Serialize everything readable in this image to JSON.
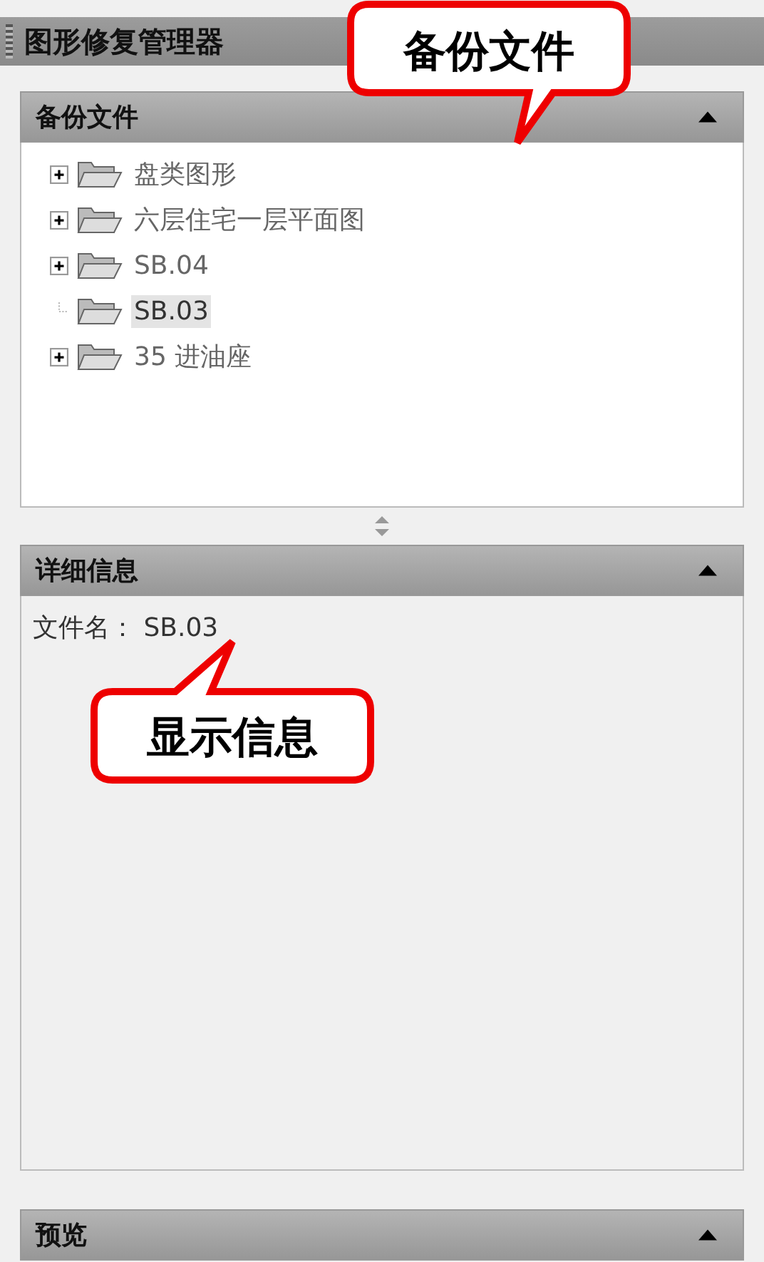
{
  "window": {
    "title": "图形修复管理器"
  },
  "backup_panel": {
    "title": "备份文件",
    "expanded": true,
    "tree": [
      {
        "label": "盘类图形",
        "expandable": true,
        "selected": false
      },
      {
        "label": "六层住宅一层平面图",
        "expandable": true,
        "selected": false
      },
      {
        "label": "SB.04",
        "expandable": true,
        "selected": false
      },
      {
        "label": "SB.03",
        "expandable": false,
        "selected": true
      },
      {
        "label": "35 进油座",
        "expandable": true,
        "selected": false
      }
    ]
  },
  "details_panel": {
    "title": "详细信息",
    "expanded": true,
    "text": "文件名： SB.03"
  },
  "preview_panel": {
    "title": "预览",
    "expanded": true
  },
  "callouts": [
    {
      "text": "备份文件"
    },
    {
      "text": "显示信息"
    }
  ]
}
